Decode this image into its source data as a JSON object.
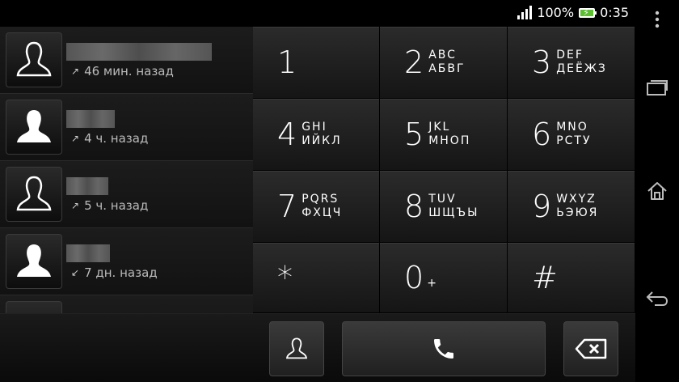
{
  "status": {
    "battery_percent": "100%",
    "time": "0:35"
  },
  "call_log": [
    {
      "time_ago": "46 мин. назад",
      "direction": "outgoing",
      "avatar": "person-outline-icon"
    },
    {
      "time_ago": "4 ч. назад",
      "direction": "outgoing",
      "avatar": "person-filled-icon"
    },
    {
      "time_ago": "5 ч. назад",
      "direction": "outgoing",
      "avatar": "person-outline-icon"
    },
    {
      "time_ago": "7 дн. назад",
      "direction": "incoming",
      "avatar": "person-filled-icon"
    }
  ],
  "keypad": [
    {
      "digit": "1",
      "latin": "",
      "cyrillic": ""
    },
    {
      "digit": "2",
      "latin": "ABC",
      "cyrillic": "АБВГ"
    },
    {
      "digit": "3",
      "latin": "DEF",
      "cyrillic": "ДЕЁЖЗ"
    },
    {
      "digit": "4",
      "latin": "GHI",
      "cyrillic": "ИЙКЛ"
    },
    {
      "digit": "5",
      "latin": "JKL",
      "cyrillic": "МНОП"
    },
    {
      "digit": "6",
      "latin": "MNO",
      "cyrillic": "РСТУ"
    },
    {
      "digit": "7",
      "latin": "PQRS",
      "cyrillic": "ФХЦЧ"
    },
    {
      "digit": "8",
      "latin": "TUV",
      "cyrillic": "ШЩЪЫ"
    },
    {
      "digit": "9",
      "latin": "WXYZ",
      "cyrillic": "ЬЭЮЯ"
    },
    {
      "digit": "*",
      "latin": "",
      "cyrillic": ""
    },
    {
      "digit": "0",
      "latin": "+",
      "cyrillic": ""
    },
    {
      "digit": "#",
      "latin": "",
      "cyrillic": ""
    }
  ],
  "colors": {
    "background": "#000000",
    "key_top": "#2b2b2b",
    "key_bottom": "#151515",
    "battery_fill": "#5bbf2f"
  }
}
